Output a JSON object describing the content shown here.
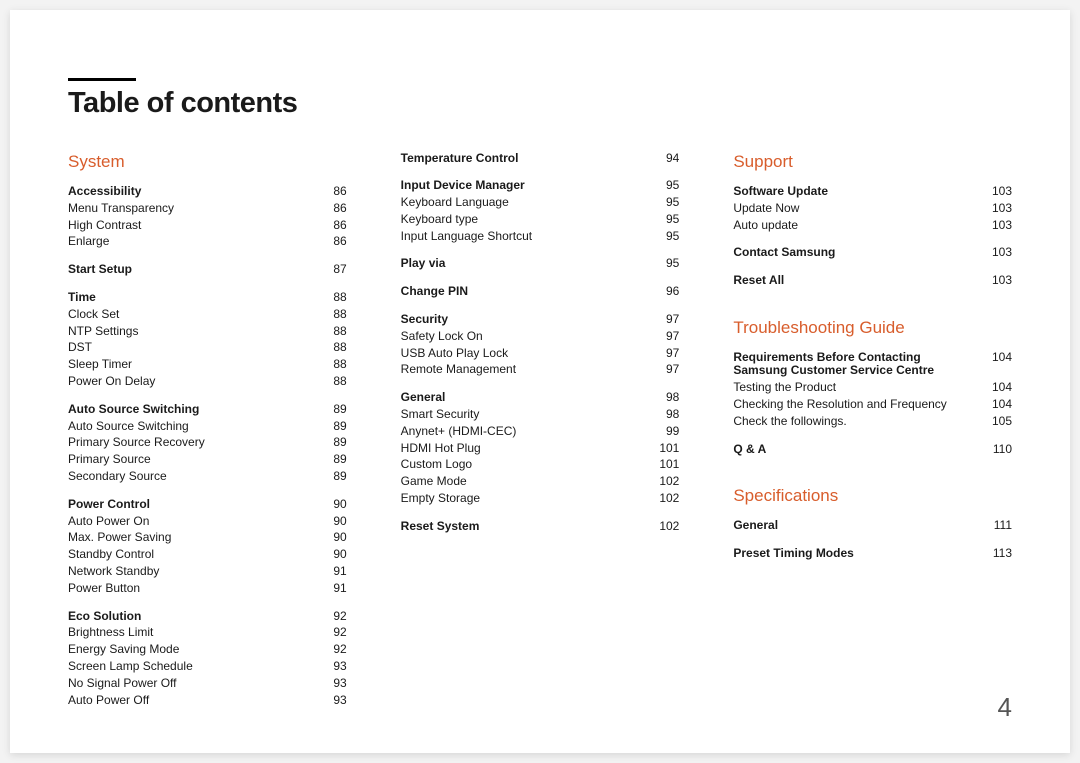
{
  "pageTitle": "Table of contents",
  "pageNumber": "4",
  "columns": [
    {
      "sections": [
        {
          "heading": "System",
          "groups": [
            {
              "rows": [
                {
                  "label": "Accessibility",
                  "page": "86",
                  "bold": true
                },
                {
                  "label": "Menu Transparency",
                  "page": "86"
                },
                {
                  "label": "High Contrast",
                  "page": "86"
                },
                {
                  "label": "Enlarge",
                  "page": "86"
                }
              ]
            },
            {
              "rows": [
                {
                  "label": "Start Setup",
                  "page": "87",
                  "bold": true
                }
              ]
            },
            {
              "rows": [
                {
                  "label": "Time",
                  "page": "88",
                  "bold": true
                },
                {
                  "label": "Clock Set",
                  "page": "88"
                },
                {
                  "label": "NTP Settings",
                  "page": "88"
                },
                {
                  "label": "DST",
                  "page": "88"
                },
                {
                  "label": "Sleep Timer",
                  "page": "88"
                },
                {
                  "label": "Power On Delay",
                  "page": "88"
                }
              ]
            },
            {
              "rows": [
                {
                  "label": "Auto Source Switching",
                  "page": "89",
                  "bold": true
                },
                {
                  "label": "Auto Source Switching",
                  "page": "89"
                },
                {
                  "label": "Primary Source Recovery",
                  "page": "89"
                },
                {
                  "label": "Primary Source",
                  "page": "89"
                },
                {
                  "label": "Secondary Source",
                  "page": "89"
                }
              ]
            },
            {
              "rows": [
                {
                  "label": "Power Control",
                  "page": "90",
                  "bold": true
                },
                {
                  "label": "Auto Power On",
                  "page": "90"
                },
                {
                  "label": "Max. Power Saving",
                  "page": "90"
                },
                {
                  "label": "Standby Control",
                  "page": "90"
                },
                {
                  "label": "Network Standby",
                  "page": "91"
                },
                {
                  "label": "Power Button",
                  "page": "91"
                }
              ]
            },
            {
              "rows": [
                {
                  "label": "Eco Solution",
                  "page": "92",
                  "bold": true
                },
                {
                  "label": "Brightness Limit",
                  "page": "92"
                },
                {
                  "label": "Energy Saving Mode",
                  "page": "92"
                },
                {
                  "label": "Screen Lamp Schedule",
                  "page": "93"
                },
                {
                  "label": "No Signal Power Off",
                  "page": "93"
                },
                {
                  "label": "Auto Power Off",
                  "page": "93"
                }
              ]
            }
          ]
        }
      ]
    },
    {
      "sections": [
        {
          "groups": [
            {
              "rows": [
                {
                  "label": "Temperature Control",
                  "page": "94",
                  "bold": true
                }
              ]
            },
            {
              "rows": [
                {
                  "label": "Input Device Manager",
                  "page": "95",
                  "bold": true
                },
                {
                  "label": "Keyboard Language",
                  "page": "95"
                },
                {
                  "label": "Keyboard type",
                  "page": "95"
                },
                {
                  "label": "Input Language Shortcut",
                  "page": "95"
                }
              ]
            },
            {
              "rows": [
                {
                  "label": "Play via",
                  "page": "95",
                  "bold": true
                }
              ]
            },
            {
              "rows": [
                {
                  "label": "Change PIN",
                  "page": "96",
                  "bold": true
                }
              ]
            },
            {
              "rows": [
                {
                  "label": "Security",
                  "page": "97",
                  "bold": true
                },
                {
                  "label": "Safety Lock On",
                  "page": "97"
                },
                {
                  "label": "USB Auto Play Lock",
                  "page": "97"
                },
                {
                  "label": "Remote Management",
                  "page": "97"
                }
              ]
            },
            {
              "rows": [
                {
                  "label": "General",
                  "page": "98",
                  "bold": true
                },
                {
                  "label": "Smart Security",
                  "page": "98"
                },
                {
                  "label": "Anynet+ (HDMI-CEC)",
                  "page": "99"
                },
                {
                  "label": "HDMI Hot Plug",
                  "page": "101"
                },
                {
                  "label": "Custom Logo",
                  "page": "101"
                },
                {
                  "label": "Game Mode",
                  "page": "102"
                },
                {
                  "label": "Empty Storage",
                  "page": "102"
                }
              ]
            },
            {
              "rows": [
                {
                  "label": "Reset System",
                  "page": "102",
                  "bold": true
                }
              ]
            }
          ]
        }
      ]
    },
    {
      "sections": [
        {
          "heading": "Support",
          "groups": [
            {
              "rows": [
                {
                  "label": "Software Update",
                  "page": "103",
                  "bold": true
                },
                {
                  "label": "Update Now",
                  "page": "103"
                },
                {
                  "label": "Auto update",
                  "page": "103"
                }
              ]
            },
            {
              "rows": [
                {
                  "label": "Contact Samsung",
                  "page": "103",
                  "bold": true
                }
              ]
            },
            {
              "rows": [
                {
                  "label": "Reset All",
                  "page": "103",
                  "bold": true
                }
              ]
            }
          ]
        },
        {
          "heading": "Troubleshooting Guide",
          "groups": [
            {
              "rows": [
                {
                  "label": "Requirements Before Contacting Samsung Customer Service Centre",
                  "page": "104",
                  "bold": true
                },
                {
                  "label": "Testing the Product",
                  "page": "104"
                },
                {
                  "label": "Checking the Resolution and Frequency",
                  "page": "104"
                },
                {
                  "label": "Check the followings.",
                  "page": "105"
                }
              ]
            },
            {
              "rows": [
                {
                  "label": "Q & A",
                  "page": "110",
                  "bold": true
                }
              ]
            }
          ]
        },
        {
          "heading": "Specifications",
          "groups": [
            {
              "rows": [
                {
                  "label": "General",
                  "page": "111",
                  "bold": true
                }
              ]
            },
            {
              "rows": [
                {
                  "label": "Preset Timing Modes",
                  "page": "113",
                  "bold": true
                }
              ]
            }
          ]
        }
      ]
    }
  ]
}
